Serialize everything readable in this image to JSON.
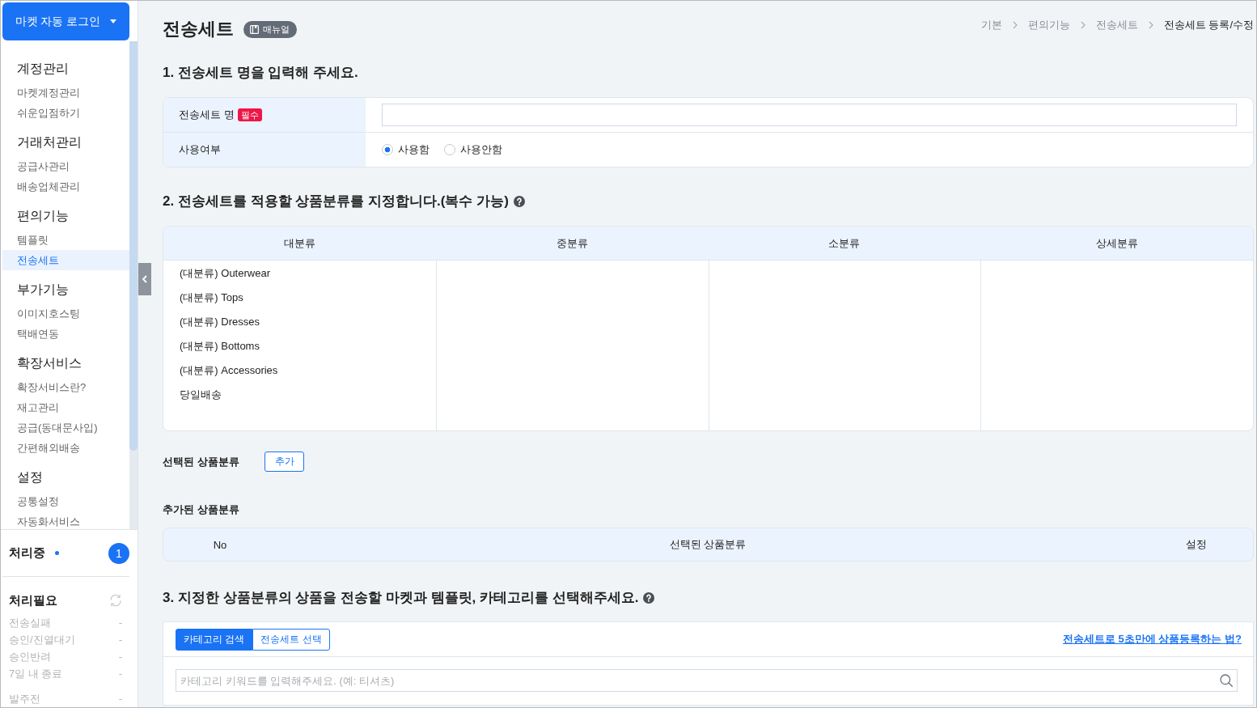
{
  "sidebar": {
    "login_button": {
      "label": "마켓 자동 로그인"
    },
    "groups": [
      {
        "title": "계정관리",
        "items": [
          {
            "label": "마켓계정관리",
            "selected": false
          },
          {
            "label": "쉬운입점하기",
            "selected": false
          }
        ]
      },
      {
        "title": "거래처관리",
        "items": [
          {
            "label": "공급사관리",
            "selected": false
          },
          {
            "label": "배송업체관리",
            "selected": false
          }
        ]
      },
      {
        "title": "편의기능",
        "items": [
          {
            "label": "템플릿",
            "selected": false
          },
          {
            "label": "전송세트",
            "selected": true
          }
        ]
      },
      {
        "title": "부가기능",
        "items": [
          {
            "label": "이미지호스팅",
            "selected": false
          },
          {
            "label": "택배연동",
            "selected": false
          }
        ]
      },
      {
        "title": "확장서비스",
        "items": [
          {
            "label": "확장서비스란?",
            "selected": false
          },
          {
            "label": "재고관리",
            "selected": false
          },
          {
            "label": "공급(동대문사입)",
            "selected": false
          },
          {
            "label": "간편해외배송",
            "selected": false
          }
        ]
      },
      {
        "title": "설정",
        "items": [
          {
            "label": "공통설정",
            "selected": false
          },
          {
            "label": "자동화서비스",
            "selected": false
          }
        ]
      }
    ],
    "processing": {
      "title": "처리중",
      "count": "1"
    },
    "needs_action": {
      "title": "처리필요",
      "sections": [
        {
          "items": [
            {
              "label": "전송실패",
              "value": "-"
            },
            {
              "label": "승인/진열대기",
              "value": "-"
            },
            {
              "label": "승인반려",
              "value": "-"
            },
            {
              "label": "7일 내 종료",
              "value": "-"
            }
          ]
        },
        {
          "items": [
            {
              "label": "발주전",
              "value": "-"
            }
          ]
        }
      ]
    }
  },
  "header": {
    "title": "전송세트",
    "manual_button": "매뉴얼",
    "breadcrumb": [
      {
        "label": "기본",
        "current": false
      },
      {
        "label": "편의기능",
        "current": false
      },
      {
        "label": "전송세트",
        "current": false
      },
      {
        "label": "전송세트 등록/수정",
        "current": true
      }
    ]
  },
  "section_1": {
    "heading": "1. 전송세트 명을 입력해 주세요.",
    "fields": [
      {
        "kind": "text",
        "label": "전송세트 명",
        "badge": "필수"
      },
      {
        "kind": "radio",
        "label": "사용여부",
        "options": [
          {
            "label": "사용함",
            "selected": true
          },
          {
            "label": "사용안함",
            "selected": false
          }
        ]
      }
    ]
  },
  "section_2": {
    "heading": "2. 전송세트를 적용할 상품분류를 지정합니다.(복수 가능)",
    "category_table": {
      "columns": [
        {
          "title": "대분류",
          "items": [
            "(대분류) Outerwear",
            "(대분류) Tops",
            "(대분류) Dresses",
            "(대분류) Bottoms",
            "(대분류) Accessories",
            "당일배송"
          ]
        },
        {
          "title": "중분류"
        },
        {
          "title": "소분류"
        },
        {
          "title": "상세분류"
        }
      ]
    },
    "selected_categories": {
      "label": "선택된 상품분류",
      "add_button": "추가"
    },
    "added_categories": {
      "label": "추가된 상품분류",
      "columns": [
        "No",
        "선택된 상품분류",
        "설정"
      ]
    }
  },
  "section_3": {
    "heading": "3. 지정한 상품분류의 상품을 전송할 마켓과 템플릿, 카테고리를 선택해주세요.",
    "tabs": [
      {
        "label": "카테고리 검색",
        "selected": true
      },
      {
        "label": "전송세트 선택",
        "selected": false
      }
    ],
    "help_link": "전송세트로 5초만에 상품등록하는 법?",
    "search": {
      "placeholder": "카테고리 키워드를 입력해주세요. (예: 티셔츠)"
    }
  }
}
